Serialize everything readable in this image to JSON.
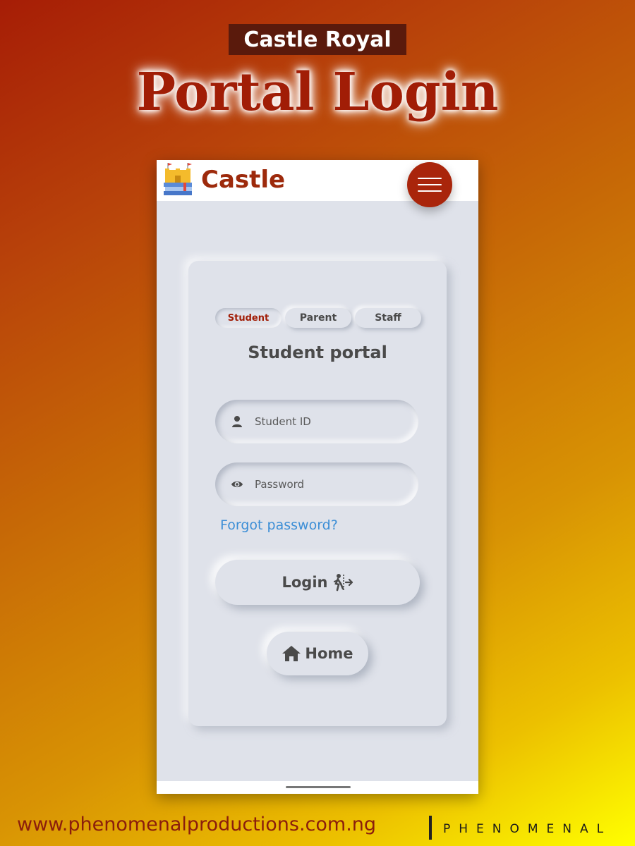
{
  "poster": {
    "top_label": "Castle Royal",
    "headline": "Portal Login",
    "footer_url": "www.phenomenalproductions.com.ng",
    "footer_brand": "PHENOMENAL"
  },
  "app": {
    "brand": "Castle",
    "logo_icon": "castle-books-icon",
    "menu_icon": "hamburger-menu-icon",
    "accent_color": "#a9250b"
  },
  "login": {
    "tabs": [
      {
        "label": "Student",
        "active": true
      },
      {
        "label": "Parent",
        "active": false
      },
      {
        "label": "Staff",
        "active": false
      }
    ],
    "title": "Student portal",
    "id_field": {
      "placeholder": "Student ID",
      "value": "",
      "icon": "user-icon"
    },
    "password_field": {
      "placeholder": "Password",
      "value": "",
      "icon": "eye-icon"
    },
    "forgot_label": "Forgot password?",
    "login_label": "Login",
    "login_icon": "person-exit-icon",
    "home_label": "Home",
    "home_icon": "home-icon"
  }
}
